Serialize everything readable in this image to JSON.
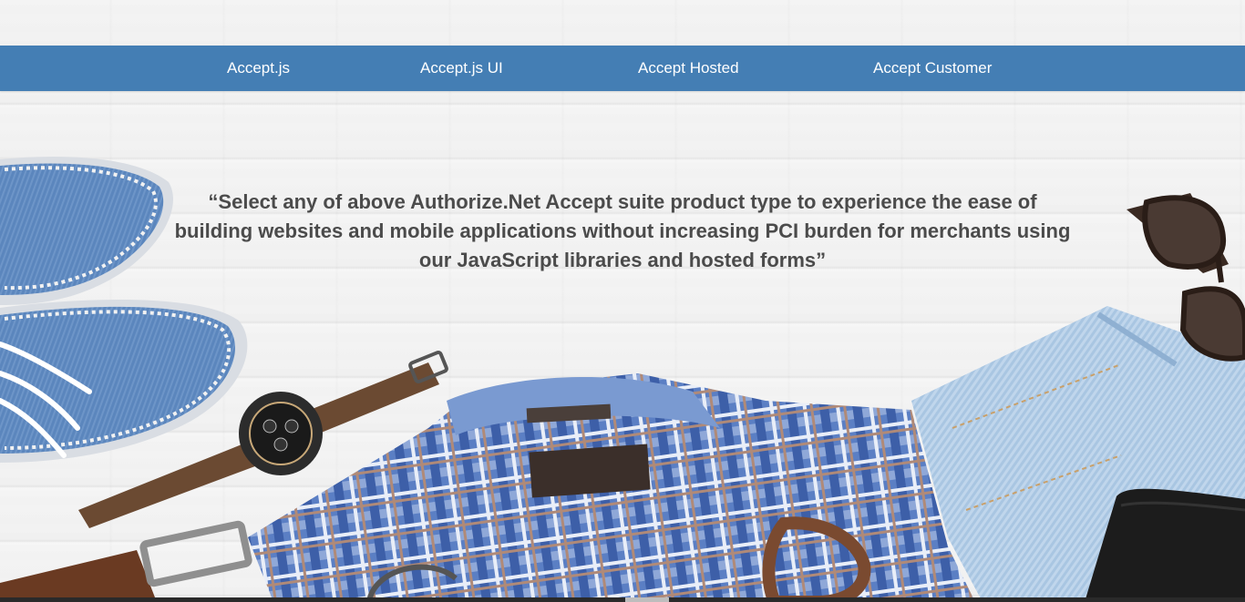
{
  "nav": {
    "items": [
      {
        "label": "Accept.js"
      },
      {
        "label": "Accept.js UI"
      },
      {
        "label": "Accept Hosted"
      },
      {
        "label": "Accept Customer"
      }
    ]
  },
  "hero": {
    "tagline": "“Select any of above Authorize.Net Accept suite product type to experience the ease of building websites and mobile applications without increasing PCI burden for merchants using our JavaScript libraries and hosted forms”"
  },
  "colors": {
    "nav_background": "#447eb4",
    "nav_text": "#ffffff",
    "tagline_text": "#4b4b4b"
  }
}
